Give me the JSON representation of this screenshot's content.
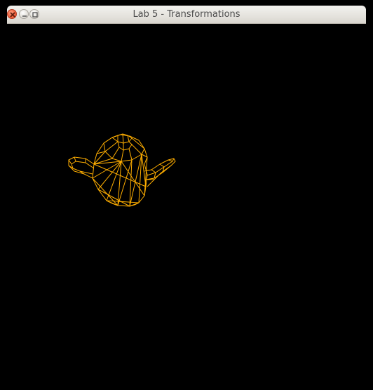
{
  "window": {
    "title": "Lab 5 - Transformations"
  },
  "controls": {
    "close_icon": "close-icon",
    "minimize_icon": "minimize-icon",
    "maximize_icon": "maximize-icon"
  },
  "scene": {
    "background_color": "#000000",
    "wire_color": "#ffae00",
    "object": "teapot-wireframe"
  }
}
